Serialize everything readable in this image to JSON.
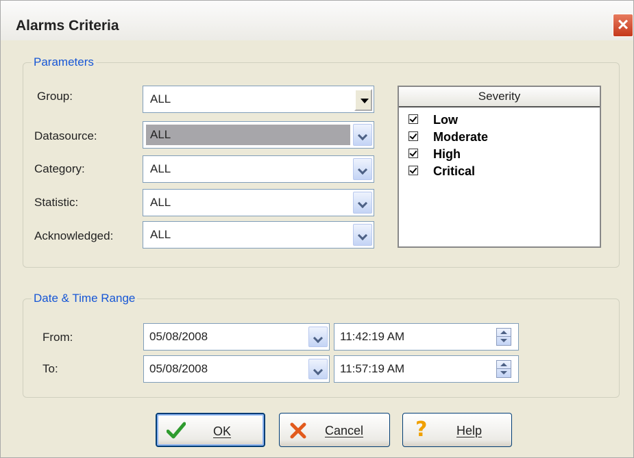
{
  "window": {
    "title": "Alarms Criteria"
  },
  "parameters": {
    "legend": "Parameters",
    "group": {
      "label": "Group:",
      "value": "ALL"
    },
    "datasource": {
      "label": "Datasource:",
      "value": "ALL"
    },
    "category": {
      "label": "Category:",
      "value": "ALL"
    },
    "statistic": {
      "label": "Statistic:",
      "value": "ALL"
    },
    "acknowledged": {
      "label": "Acknowledged:",
      "value": "ALL"
    }
  },
  "severity": {
    "header": "Severity",
    "items": [
      {
        "label": "Low",
        "checked": true
      },
      {
        "label": "Moderate",
        "checked": true
      },
      {
        "label": "High",
        "checked": true
      },
      {
        "label": "Critical",
        "checked": true
      }
    ]
  },
  "date_range": {
    "legend": "Date & Time Range",
    "from": {
      "label": "From:",
      "date": "05/08/2008",
      "time": "11:42:19 AM"
    },
    "to": {
      "label": "To:",
      "date": "05/08/2008",
      "time": "11:57:19 AM"
    }
  },
  "buttons": {
    "ok": "OK",
    "cancel": "Cancel",
    "help": "Help"
  },
  "icons": {
    "ok": "checkmark-icon",
    "cancel": "x-icon",
    "help": "question-icon",
    "close": "close-icon"
  },
  "colors": {
    "accent": "#1656d6",
    "ok_icon": "#2e9b2e",
    "cancel_icon": "#e25a1c",
    "help_icon": "#f0a000"
  }
}
